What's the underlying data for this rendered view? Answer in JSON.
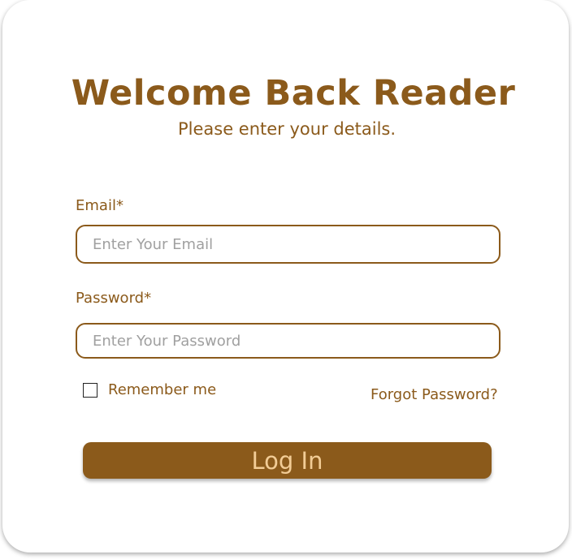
{
  "colors": {
    "brand": "#8B5A1B",
    "button_text": "#F2CC96",
    "placeholder": "#A0A0A0"
  },
  "header": {
    "title": "Welcome Back Reader",
    "subtitle": "Please enter your details."
  },
  "form": {
    "email": {
      "label": "Email*",
      "placeholder": "Enter Your Email",
      "value": ""
    },
    "password": {
      "label": "Password*",
      "placeholder": "Enter Your Password",
      "value": ""
    },
    "remember": {
      "label": "Remember me",
      "checked": false
    },
    "forgot_label": "Forgot Password?",
    "submit_label": "Log In"
  }
}
